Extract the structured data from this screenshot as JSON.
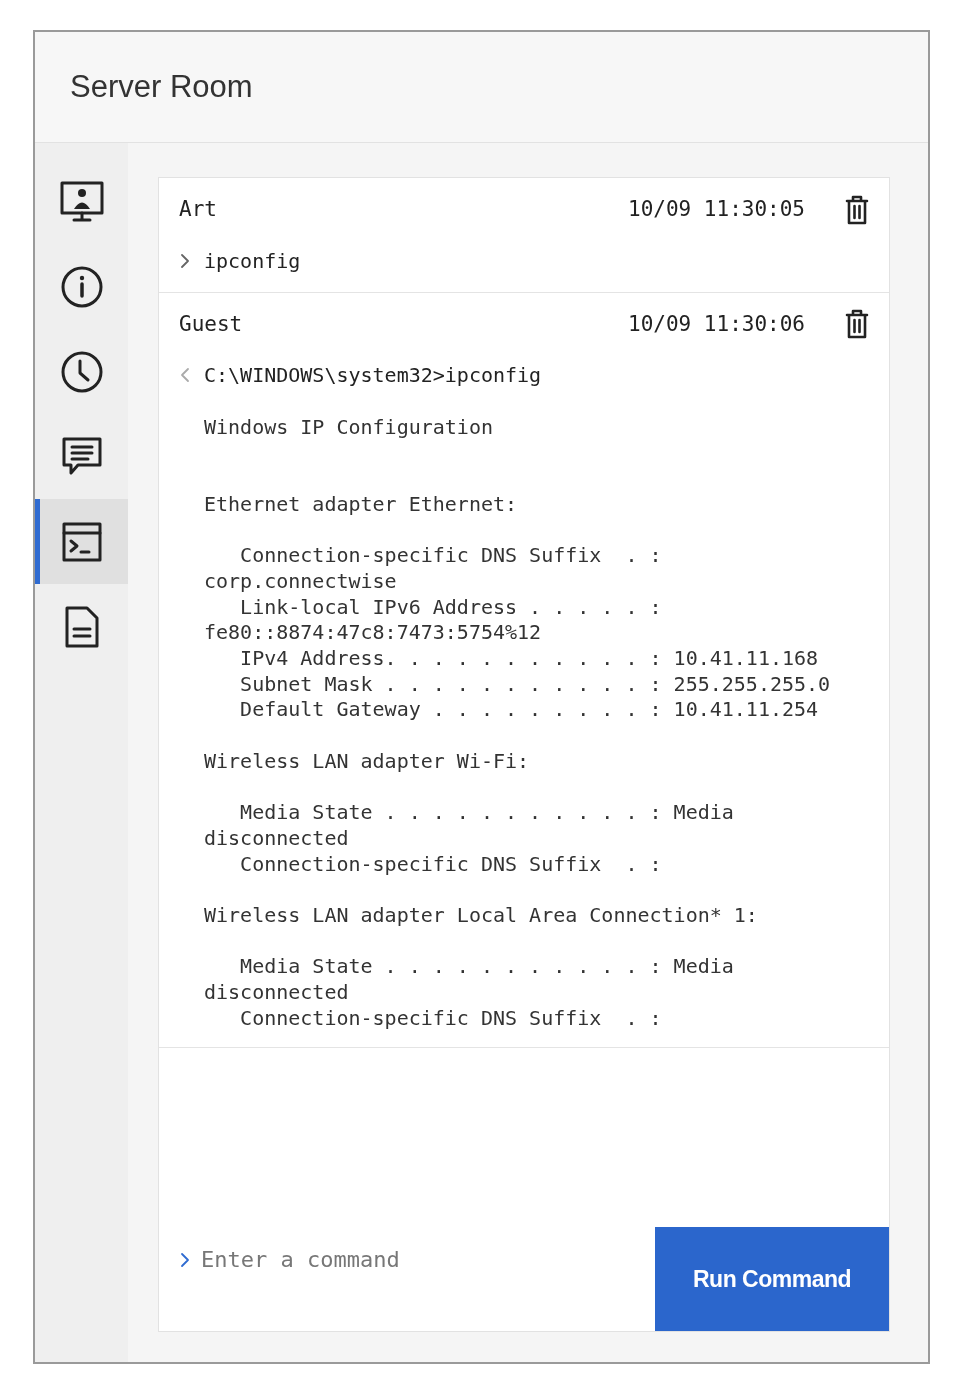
{
  "window": {
    "title": "Server Room"
  },
  "sidebar": {
    "items": [
      {
        "selected": false
      },
      {
        "selected": false
      },
      {
        "selected": false
      },
      {
        "selected": false
      },
      {
        "selected": true
      },
      {
        "selected": false
      }
    ]
  },
  "entries": [
    {
      "user": "Art",
      "time": "10/09 11:30:05",
      "kind": "command",
      "text": "ipconfig"
    },
    {
      "user": "Guest",
      "time": "10/09 11:30:06",
      "kind": "response",
      "text": "C:\\WINDOWS\\system32>ipconfig",
      "output_blocks": [
        [
          "Windows IP Configuration"
        ],
        [
          "Ethernet adapter Ethernet:"
        ],
        [
          "   Connection-specific DNS Suffix  . :",
          "corp.connectwise",
          "   Link-local IPv6 Address . . . . . :",
          "fe80::8874:47c8:7473:5754%12",
          "   IPv4 Address. . . . . . . . . . . : 10.41.11.168",
          "   Subnet Mask . . . . . . . . . . . : 255.255.255.0",
          "   Default Gateway . . . . . . . . . : 10.41.11.254"
        ],
        [
          "Wireless LAN adapter Wi-Fi:"
        ],
        [
          "   Media State . . . . . . . . . . . : Media",
          "disconnected",
          "   Connection-specific DNS Suffix  . :"
        ],
        [
          "Wireless LAN adapter Local Area Connection* 1:"
        ],
        [
          "   Media State . . . . . . . . . . . : Media",
          "disconnected",
          "   Connection-specific DNS Suffix  . :"
        ]
      ]
    }
  ],
  "command_input": {
    "placeholder": "Enter a command"
  },
  "run_button": {
    "label": "Run Command"
  }
}
